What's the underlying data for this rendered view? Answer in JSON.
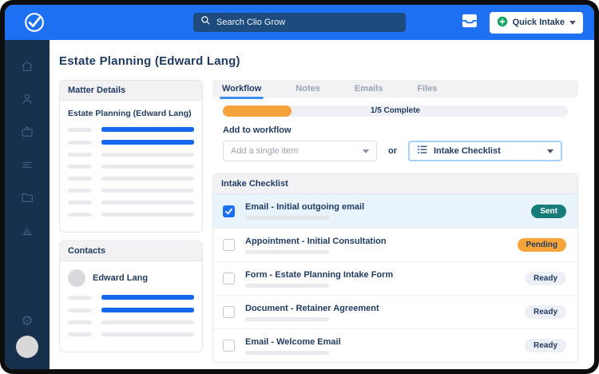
{
  "topbar": {
    "search_placeholder": "Search Clio Grow",
    "quick_intake_label": "Quick Intake"
  },
  "page": {
    "title": "Estate Planning (Edward Lang)"
  },
  "matter_details": {
    "header": "Matter Details",
    "matter_name": "Estate Planning (Edward Lang)",
    "skeleton_rows": [
      {
        "accent": true
      },
      {
        "accent": true
      },
      {
        "accent": false
      },
      {
        "accent": false
      },
      {
        "accent": false
      },
      {
        "accent": false
      },
      {
        "accent": false
      },
      {
        "accent": false
      }
    ]
  },
  "contacts": {
    "header": "Contacts",
    "name": "Edward Lang",
    "skeleton_rows": [
      {
        "accent": true
      },
      {
        "accent": true
      },
      {
        "accent": false
      },
      {
        "accent": false
      }
    ]
  },
  "workflow": {
    "tabs": [
      {
        "label": "Workflow",
        "active": true
      },
      {
        "label": "Notes",
        "active": false
      },
      {
        "label": "Emails",
        "active": false
      },
      {
        "label": "Files",
        "active": false
      }
    ],
    "progress_label": "1/5 Complete",
    "progress_percent": 20,
    "add_to_workflow_label": "Add to workflow",
    "single_item_placeholder": "Add a single item",
    "or_label": "or",
    "checklist_dropdown_label": "Intake Checklist"
  },
  "checklist": {
    "header": "Intake Checklist",
    "items": [
      {
        "title": "Email - Initial outgoing email",
        "status": "Sent",
        "checked": true
      },
      {
        "title": "Appointment - Initial Consultation",
        "status": "Pending",
        "checked": false
      },
      {
        "title": "Form - Estate Planning Intake Form",
        "status": "Ready",
        "checked": false
      },
      {
        "title": "Document - Retainer Agreement",
        "status": "Ready",
        "checked": false
      },
      {
        "title": "Email - Welcome Email",
        "status": "Ready",
        "checked": false
      }
    ]
  },
  "colors": {
    "brand-blue": "#1e70f2",
    "sidebar-navy": "#16304e",
    "text-navy": "#1f3a5f",
    "accent-blue": "#1467ee",
    "progress-orange": "#f6a33c",
    "status-sent-teal": "#177d78",
    "status-pending-orange": "#f7a53b",
    "status-ready-gray": "#edeff6",
    "selected-row-blue": "#e9f3fb",
    "quick-intake-green": "#17a15e"
  }
}
